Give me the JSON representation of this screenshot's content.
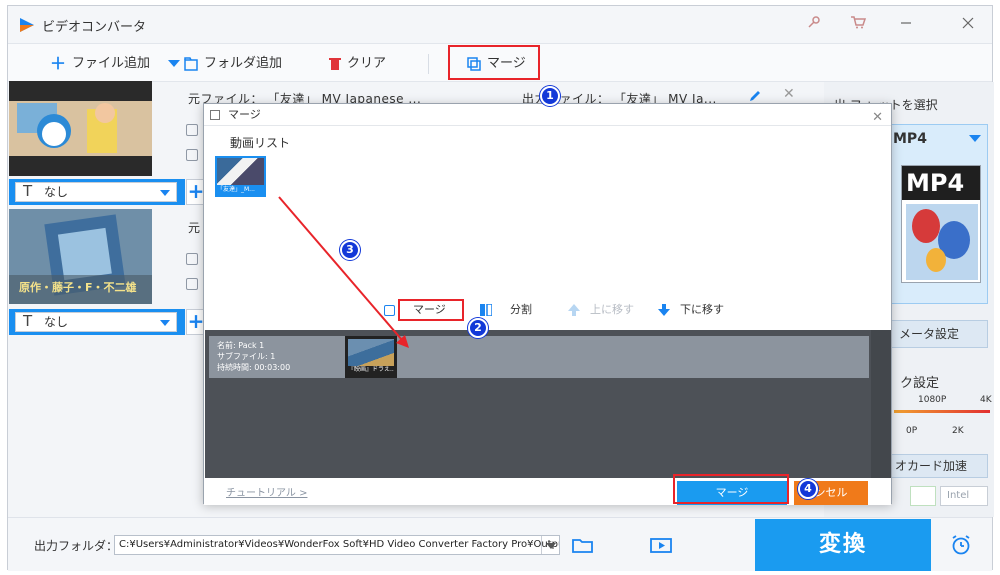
{
  "window": {
    "title": "ビデオコンバータ",
    "key_icon": "key-icon",
    "cart_icon": "cart-icon"
  },
  "toolbar": {
    "add_file": "ファイル追加",
    "add_folder": "フォルダ追加",
    "clear": "クリア",
    "merge": "マージ"
  },
  "files": [
    {
      "source_label": "元ファイル：",
      "source_name": "「友達」 MV  Japanese ...",
      "output_label": "出力ファイル：",
      "output_name": "「友達」 MV  Ja...",
      "subtitle": "なし"
    },
    {
      "source_label": "元",
      "subtitle": "なし",
      "thumb_caption": "原作・藤子・F・不二雄"
    }
  ],
  "right_panel": {
    "select_format_label": "出力フォーマットを選択",
    "visible_select_label": "出 フォ  ットを選択",
    "format": "MP4",
    "format_big": "MP4",
    "param_settings": "メータ設定",
    "quality_settings": "ク設定",
    "quality_ticks_top": [
      "1080P",
      "4K"
    ],
    "quality_ticks_bottom": [
      "0P",
      "2K"
    ],
    "gpu_accel": "オカード加速",
    "intel": "Intel"
  },
  "dialog": {
    "title": "マージ",
    "video_list_label": "動画リスト",
    "video_chip_caption": "「友達」_M...",
    "buttons": {
      "merge": "マージ",
      "split": "分割",
      "move_up": "上に移す",
      "move_down": "下に移す"
    },
    "pack": {
      "name": "名前: Pack 1",
      "sub_files": "サブファイル: 1",
      "duration": "持続時間: 00:03:00",
      "thumb_caption": "『映画』ドラえ..."
    },
    "tutorial": "チュートリアル >",
    "ok": "マージ",
    "cancel": "ンセル"
  },
  "bottom": {
    "output_folder_label": "出力フォルダ：",
    "output_path": "C:¥Users¥Administrator¥Videos¥WonderFox Soft¥HD Video Converter Factory Pro¥OutputVideo¥",
    "convert": "変換"
  },
  "steps": [
    "1",
    "2",
    "3",
    "4"
  ],
  "colors": {
    "accent": "#1a9bf0",
    "highlight_box": "#e8242a",
    "step_badge": "#1238d8",
    "cancel": "#f07a1a"
  }
}
